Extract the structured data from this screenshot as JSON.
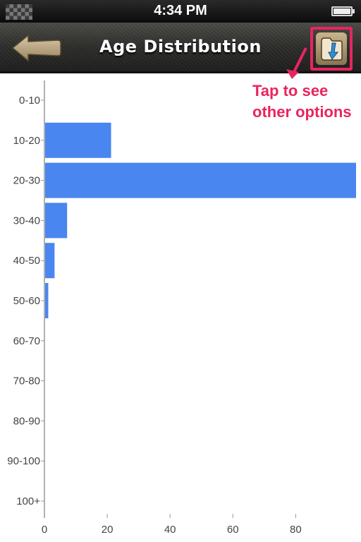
{
  "status_bar": {
    "time": "4:34 PM"
  },
  "nav": {
    "title": "Age Distribution"
  },
  "annotation": {
    "line1": "Tap to see",
    "line2": "other options"
  },
  "colors": {
    "bar": "#4a86f0",
    "accent": "#e8255f",
    "axis": "#999999"
  },
  "icons": {
    "back": "back-arrow-icon",
    "options": "folder-download-icon"
  },
  "chart_data": {
    "type": "bar",
    "orientation": "horizontal",
    "categories": [
      "0-10",
      "10-20",
      "20-30",
      "30-40",
      "40-50",
      "50-60",
      "60-70",
      "70-80",
      "80-90",
      "90-100",
      "100+"
    ],
    "values": [
      0,
      21,
      99,
      7,
      3,
      1,
      0,
      0,
      0,
      0,
      0
    ],
    "xticks": [
      "0",
      "20",
      "40",
      "60",
      "80"
    ],
    "xlim": [
      0,
      99
    ],
    "grid": false
  }
}
